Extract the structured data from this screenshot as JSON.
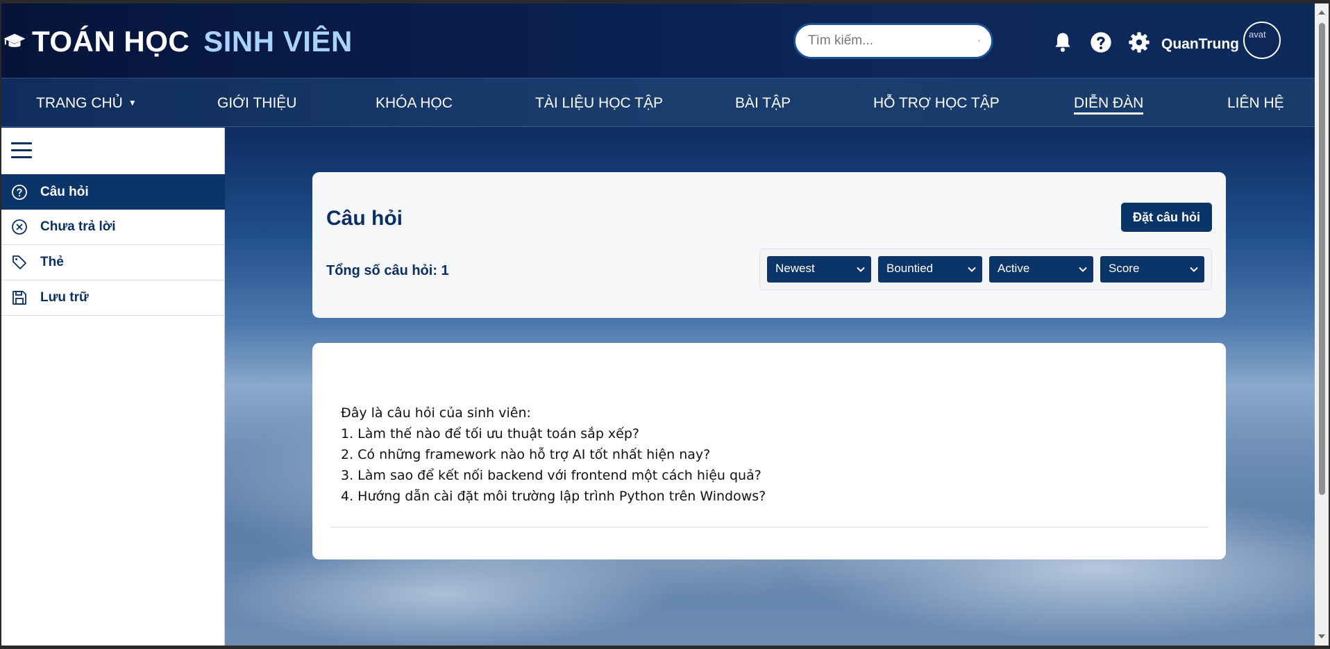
{
  "header": {
    "brand_part1": "TOÁN HỌC",
    "brand_part2": "SINH VIÊN",
    "search_placeholder": "Tìm kiếm...",
    "username": "QuanTrung",
    "avatar_alt": "avat"
  },
  "nav": {
    "items": [
      {
        "label": "TRANG CHỦ",
        "caret": "▼"
      },
      {
        "label": "GIỚI THIỆU"
      },
      {
        "label": "KHÓA HỌC"
      },
      {
        "label": "TÀI LIỆU HỌC TẬP"
      },
      {
        "label": "BÀI TẬP"
      },
      {
        "label": "HỖ TRỢ HỌC TẬP"
      },
      {
        "label": "DIỄN ĐÀN",
        "active": true
      },
      {
        "label": "LIÊN HỆ"
      }
    ]
  },
  "sidebar": {
    "items": [
      {
        "label": "Câu hỏi",
        "icon": "question-circle-icon",
        "active": true
      },
      {
        "label": "Chưa trả lời",
        "icon": "x-circle-icon"
      },
      {
        "label": "Thẻ",
        "icon": "tag-icon"
      },
      {
        "label": "Lưu trữ",
        "icon": "save-icon"
      }
    ]
  },
  "questions": {
    "title": "Câu hỏi",
    "ask_button": "Đặt câu hỏi",
    "count_label": "Tổng số câu hỏi: 1",
    "filters": [
      "Newest",
      "Bountied",
      "Active",
      "Score"
    ]
  },
  "post": {
    "lines": [
      "Đây là câu hỏi của sinh viên:",
      "1. Làm thế nào để tối ưu thuật toán sắp xếp?",
      "2. Có những framework nào hỗ trợ AI tốt nhất hiện nay?",
      "3. Làm sao để kết nối backend với frontend một cách hiệu quả?",
      "4. Hướng dẫn cài đặt môi trường lập trình Python trên Windows?"
    ]
  },
  "colors": {
    "primary": "#0b3468",
    "brand_accent": "#a9d2ff",
    "header_bg": "#06143a"
  }
}
